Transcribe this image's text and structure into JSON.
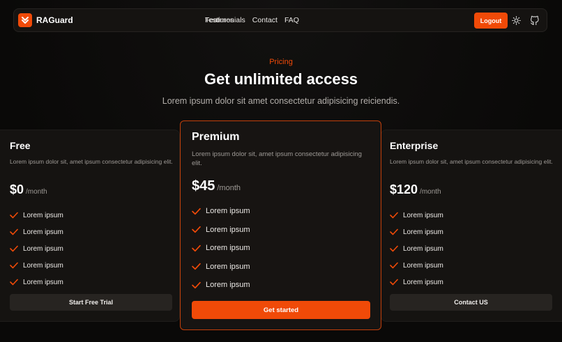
{
  "brand": {
    "name": "RAGuard",
    "color": "#f04a08",
    "logo_icon": "chevrons-down-icon"
  },
  "nav": {
    "links": [
      {
        "label": "Features",
        "has_dropdown": true
      },
      {
        "label": "Testimonials"
      },
      {
        "label": "Contact"
      },
      {
        "label": "FAQ"
      }
    ],
    "logout_label": "Logout",
    "theme_icon": "sun-icon",
    "repo_icon": "github-icon"
  },
  "header": {
    "eyebrow": "Pricing",
    "title": "Get unlimited access",
    "subtitle": "Lorem ipsum dolor sit amet consectetur adipisicing reiciendis."
  },
  "plans": [
    {
      "name": "Free",
      "description": "Lorem ipsum dolor sit, amet ipsum consectetur adipisicing elit.",
      "price": "$0",
      "period": "/month",
      "features": [
        "Lorem ipsum",
        "Lorem ipsum",
        "Lorem ipsum",
        "Lorem ipsum",
        "Lorem ipsum"
      ],
      "cta": "Start Free Trial",
      "highlighted": false
    },
    {
      "name": "Premium",
      "description": "Lorem ipsum dolor sit, amet ipsum consectetur adipisicing elit.",
      "price": "$45",
      "period": "/month",
      "features": [
        "Lorem ipsum",
        "Lorem ipsum",
        "Lorem ipsum",
        "Lorem ipsum",
        "Lorem ipsum"
      ],
      "cta": "Get started",
      "highlighted": true
    },
    {
      "name": "Enterprise",
      "description": "Lorem ipsum dolor sit, amet ipsum consectetur adipisicing elit.",
      "price": "$120",
      "period": "/month",
      "features": [
        "Lorem ipsum",
        "Lorem ipsum",
        "Lorem ipsum",
        "Lorem ipsum",
        "Lorem ipsum"
      ],
      "cta": "Contact US",
      "highlighted": false
    }
  ],
  "colors": {
    "accent": "#f04a08",
    "background": "#0b0a09",
    "card": "#151311"
  }
}
